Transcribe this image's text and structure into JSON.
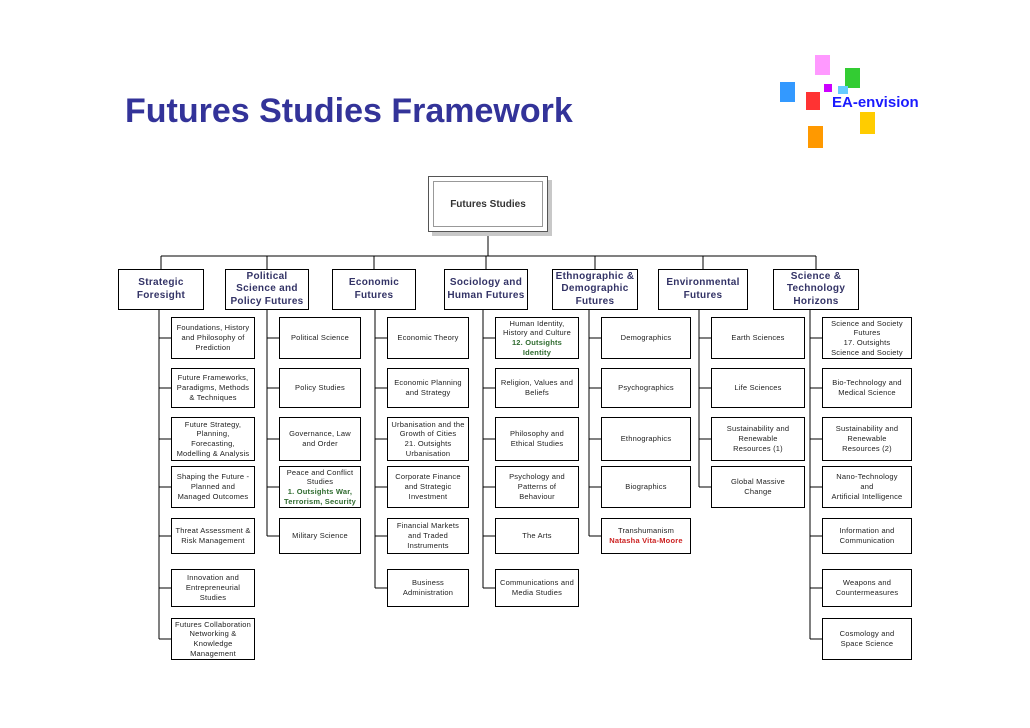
{
  "title": "Futures Studies Framework",
  "logo": {
    "text": "EA-envision",
    "colors": [
      "#ff99ff",
      "#33cc33",
      "#3399ff",
      "#ff3333",
      "#ffcc00",
      "#ff9900",
      "#cc00ff",
      "#66ccff"
    ]
  },
  "root": {
    "label": "Futures Studies"
  },
  "categories": [
    {
      "label": "Strategic\nForesight",
      "leaves": [
        [
          "Foundations, History\nand Philosophy of\nPrediction"
        ],
        [
          "Future Frameworks,\nParadigms, Methods\n& Techniques"
        ],
        [
          "Future Strategy,\nPlanning,\nForecasting,\nModelling & Analysis"
        ],
        [
          "Shaping the Future -\nPlanned and\nManaged Outcomes"
        ],
        [
          "Threat Assessment &\nRisk Management"
        ],
        [
          "Innovation and\nEntrepreneurial\nStudies"
        ],
        [
          "Futures Collaboration\nNetworking &\nKnowledge\nManagement"
        ]
      ]
    },
    {
      "label": "Political\nScience and\nPolicy Futures",
      "leaves": [
        [
          "Political Science"
        ],
        [
          "Policy Studies"
        ],
        [
          "Governance, Law\nand Order"
        ],
        [
          "Peace and Conflict\nStudies",
          "1. Outsights War,\nTerrorism, Security"
        ],
        [
          "Military Science"
        ]
      ]
    },
    {
      "label": "Economic\nFutures",
      "leaves": [
        [
          "Economic Theory"
        ],
        [
          "Economic Planning\nand Strategy"
        ],
        [
          "Urbanisation and the\nGrowth of Cities\n21. Outsights\nUrbanisation"
        ],
        [
          "Corporate Finance\nand Strategic\nInvestment"
        ],
        [
          "Financial Markets\nand Traded\nInstruments"
        ],
        [
          "Business\nAdministration"
        ]
      ]
    },
    {
      "label": "Sociology and\nHuman Futures",
      "leaves": [
        [
          "Human Identity,\nHistory and Culture",
          "12. Outsights\nIdentity"
        ],
        [
          "Religion, Values and\nBeliefs"
        ],
        [
          "Philosophy and\nEthical Studies"
        ],
        [
          "Psychology and\nPatterns of Behaviour"
        ],
        [
          "The Arts"
        ],
        [
          "Communications and\nMedia Studies"
        ]
      ]
    },
    {
      "label": "Ethnographic &\nDemographic\nFutures",
      "leaves": [
        [
          "Demographics"
        ],
        [
          "Psychographics"
        ],
        [
          "Ethnographics"
        ],
        [
          "Biographics"
        ],
        [
          "Transhumanism",
          "Natasha Vita-Moore"
        ]
      ]
    },
    {
      "label": "Environmental\nFutures",
      "leaves": [
        [
          "Earth Sciences"
        ],
        [
          "Life Sciences"
        ],
        [
          "Sustainability and\nRenewable\nResources (1)"
        ],
        [
          "Global Massive\nChange"
        ]
      ]
    },
    {
      "label": "Science &\nTechnology\nHorizons",
      "leaves": [
        [
          "Science and Society\nFutures\n17. Outsights\nScience and Society"
        ],
        [
          "Bio-Technology and\nMedical Science"
        ],
        [
          "Sustainability and\nRenewable\nResources (2)"
        ],
        [
          "Nano-Technology\nand\nArtificial Intelligence"
        ],
        [
          "Information and\nCommunication"
        ],
        [
          "Weapons and\nCountermeasures"
        ],
        [
          "Cosmology and\nSpace Science"
        ]
      ]
    }
  ]
}
